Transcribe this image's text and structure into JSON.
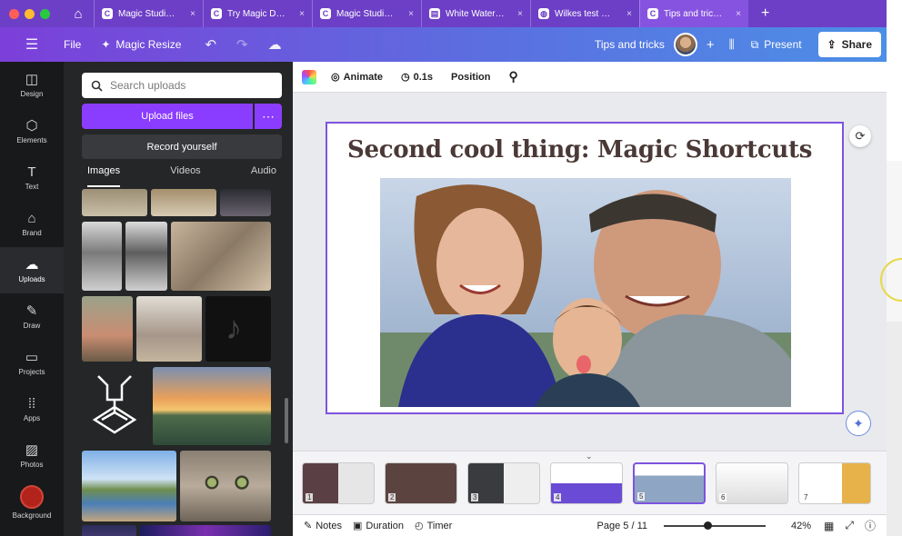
{
  "browser": {
    "tabs": [
      {
        "icon": "canva-icon",
        "title": "Magic Studio Mag...",
        "active": false
      },
      {
        "icon": "canva-icon",
        "title": "Try Magic Design ...",
        "active": false
      },
      {
        "icon": "canva-icon",
        "title": "Magic Studio Mag...",
        "active": false
      },
      {
        "icon": "doc-icon",
        "title": "White Watercolor ...",
        "active": false
      },
      {
        "icon": "globe-icon",
        "title": "Wilkes test websit...",
        "active": false
      },
      {
        "icon": "canva-icon",
        "title": "Tips and tricks - P...",
        "active": true
      }
    ],
    "close_glyph": "×",
    "new_tab": "+"
  },
  "header": {
    "file": "File",
    "magic_resize": "Magic Resize",
    "doc_title": "Tips and tricks",
    "present": "Present",
    "share": "Share"
  },
  "rail": [
    {
      "label": "Design",
      "icon": "layout-icon"
    },
    {
      "label": "Elements",
      "icon": "shapes-icon"
    },
    {
      "label": "Text",
      "icon": "text-icon"
    },
    {
      "label": "Brand",
      "icon": "brand-icon"
    },
    {
      "label": "Uploads",
      "icon": "cloud-upload-icon",
      "active": true
    },
    {
      "label": "Draw",
      "icon": "pen-icon"
    },
    {
      "label": "Projects",
      "icon": "folder-icon"
    },
    {
      "label": "Apps",
      "icon": "apps-grid-icon"
    },
    {
      "label": "Photos",
      "icon": "photo-icon"
    },
    {
      "label": "Background",
      "icon": "background-icon"
    }
  ],
  "panel": {
    "search_placeholder": "Search uploads",
    "upload_files": "Upload files",
    "record_yourself": "Record yourself",
    "tabs": [
      "Images",
      "Videos",
      "Audio"
    ],
    "active_tab": "Images"
  },
  "toolbar": {
    "animate": "Animate",
    "duration": "0.1s",
    "position": "Position"
  },
  "slide": {
    "title": "Second cool thing: Magic Shortcuts"
  },
  "pages": [
    "1",
    "2",
    "3",
    "4",
    "5",
    "6",
    "7"
  ],
  "current_page_index": 5,
  "footer": {
    "notes": "Notes",
    "duration": "Duration",
    "timer": "Timer",
    "page_indicator": "Page 5 / 11",
    "zoom": "42%",
    "zoom_fraction": 0.42
  },
  "colors": {
    "brand_purple": "#8b3dff",
    "selection": "#7d53de"
  }
}
